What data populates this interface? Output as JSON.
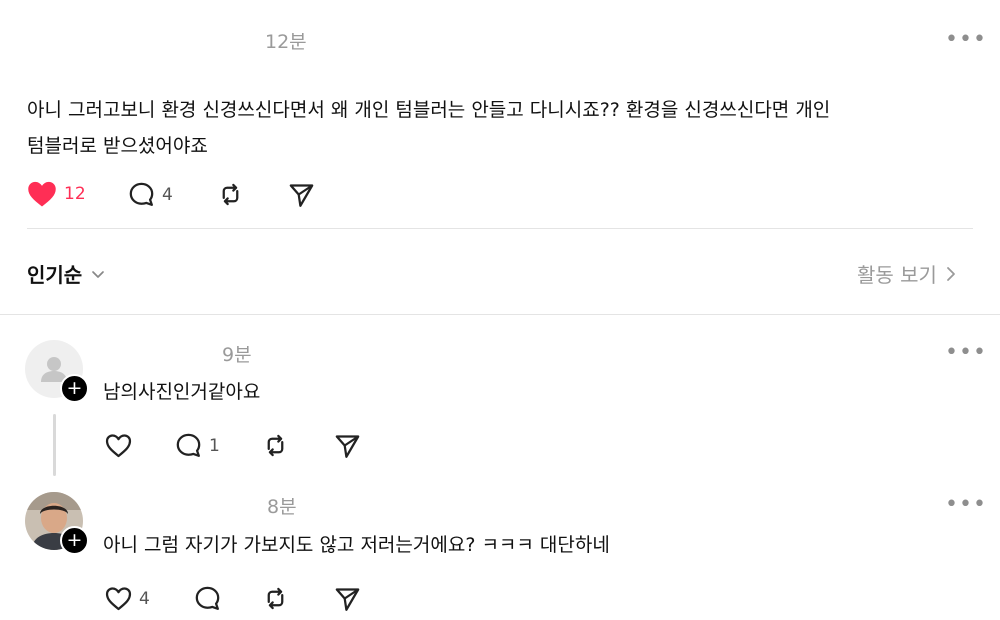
{
  "main_post": {
    "timestamp": "12분",
    "body_line1": "아니 그러고보니 환경 신경쓰신다면서 왜 개인 텀블러는 안들고 다니시죠?? 환경을 신경쓰신다면 개인",
    "body_line2": "텀블러로 받으셨어야죠",
    "like_count": "12",
    "comment_count": "4"
  },
  "sort_bar": {
    "sort_label": "인기순",
    "activity_label": "활동 보기"
  },
  "replies": [
    {
      "timestamp": "9분",
      "text": "남의사진인거같아요",
      "like_count": "",
      "comment_count": "1"
    },
    {
      "timestamp": "8분",
      "text": "아니 그럼 자기가 가보지도 않고 저러는거에요? ㅋㅋㅋ 대단하네",
      "like_count": "4",
      "comment_count": ""
    }
  ],
  "colors": {
    "like_active": "#ff2e55",
    "muted_text": "#9a9a9a",
    "divider": "#e4e4e4"
  },
  "icons": [
    "heart-icon",
    "comment-icon",
    "repost-icon",
    "share-icon",
    "more-icon",
    "chevron-down-icon",
    "chevron-right-icon",
    "plus-icon",
    "default-avatar-icon"
  ]
}
